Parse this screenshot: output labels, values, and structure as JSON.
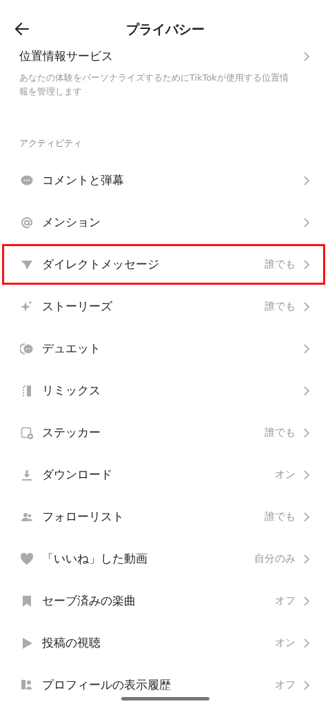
{
  "header": {
    "title": "プライバシー"
  },
  "location": {
    "title": "位置情報サービス",
    "description": "あなたの体験をパーソナライズするためにTikTokが使用する位置情報を管理します"
  },
  "section": {
    "title": "アクティビティ"
  },
  "items": [
    {
      "kind": "comment",
      "label": "コメントと弾幕",
      "highlighted": false
    },
    {
      "kind": "mention",
      "label": "メンション",
      "highlighted": false
    },
    {
      "kind": "send",
      "label": "ダイレクトメッセージ",
      "value": "誰でも",
      "highlighted": true
    },
    {
      "kind": "sparkle",
      "label": "ストーリーズ",
      "value": "誰でも",
      "highlighted": false
    },
    {
      "kind": "duet",
      "label": "デュエット",
      "highlighted": false
    },
    {
      "kind": "remix",
      "label": "リミックス",
      "highlighted": false
    },
    {
      "kind": "sticker",
      "label": "ステッカー",
      "value": "誰でも",
      "highlighted": false
    },
    {
      "kind": "download",
      "label": "ダウンロード",
      "value": "オン",
      "highlighted": false
    },
    {
      "kind": "people",
      "label": "フォローリスト",
      "value": "誰でも",
      "highlighted": false
    },
    {
      "kind": "heart",
      "label": "「いいね」した動画",
      "value": "自分のみ",
      "highlighted": false
    },
    {
      "kind": "bookmark",
      "label": "セーブ済みの楽曲",
      "value": "オフ",
      "highlighted": false
    },
    {
      "kind": "play",
      "label": "投稿の視聴",
      "value": "オン",
      "highlighted": false
    },
    {
      "kind": "profile",
      "label": "プロフィールの表示履歴",
      "value": "オフ",
      "highlighted": false
    }
  ]
}
